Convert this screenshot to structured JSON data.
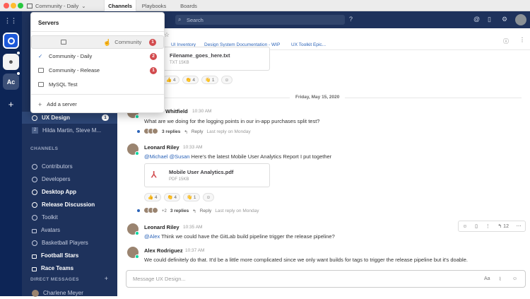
{
  "window": {
    "server_selector": "Community - Daily",
    "tabs": [
      "Channels",
      "Playbooks",
      "Boards"
    ]
  },
  "rail": {
    "team_initials": "Ac"
  },
  "global": {
    "search_placeholder": "Search"
  },
  "channel_header": {
    "bookmarks": [
      "UI Inventory",
      "Design System Documentation - WIP",
      "UX Toolkit Epic..."
    ]
  },
  "sidebar": {
    "items_top": [
      {
        "label": "UX Design",
        "badge": "1"
      },
      {
        "label": "Hilda Martin, Steve M...",
        "badge": "2"
      }
    ],
    "channels_title": "CHANNELS",
    "channels": [
      {
        "label": "Contributors",
        "bold": false,
        "lock": false
      },
      {
        "label": "Developers",
        "bold": false,
        "lock": false
      },
      {
        "label": "Desktop App",
        "bold": true,
        "lock": false
      },
      {
        "label": "Release Discussion",
        "bold": true,
        "lock": false
      },
      {
        "label": "Toolkit",
        "bold": false,
        "lock": false
      },
      {
        "label": "Avatars",
        "bold": false,
        "lock": true
      },
      {
        "label": "Basketball Players",
        "bold": false,
        "lock": false
      },
      {
        "label": "Football Stars",
        "bold": true,
        "lock": true
      },
      {
        "label": "Race Teams",
        "bold": true,
        "lock": true
      }
    ],
    "dm_title": "DIRECT MESSAGES",
    "dm_first": "Charlene Meyer"
  },
  "dropdown": {
    "title": "Servers",
    "servers": [
      {
        "name": "Community",
        "badge": "1",
        "selected": false
      },
      {
        "name": "Community - Daily",
        "badge": "2",
        "selected": true
      },
      {
        "name": "Community - Release",
        "badge": "1",
        "selected": false
      },
      {
        "name": "MySQL Test",
        "badge": "",
        "selected": false
      }
    ],
    "add_label": "Add a server"
  },
  "posts": {
    "top_file": {
      "name": "Filename_goes_here.txt",
      "meta": "TXT 15KB"
    },
    "top_reacts": [
      "👍 4",
      "👏 4",
      "👋 1",
      "☺"
    ],
    "date": "Friday, May 15, 2020",
    "p1": {
      "name": "Whitfield",
      "time": "10:30 AM",
      "text": "What are we doing for the logging points in our in-app purchases split test?",
      "thread": {
        "replies": "3 replies",
        "reply": "Reply",
        "last": "Last reply on Monday"
      }
    },
    "p2": {
      "name": "Leonard Riley",
      "time": "10:33 AM",
      "m1": "@Michael",
      "m2": "@Susan",
      "text": "Here's the latest Mobile User Analytics Report I put together",
      "file": {
        "name": "Mobile User Analytics.pdf",
        "meta": "PDF 15KB"
      },
      "reacts": [
        "👍 4",
        "👏 4",
        "👋 1",
        "☺"
      ],
      "thread": {
        "more": "+2",
        "replies": "3 replies",
        "reply": "Reply",
        "last": "Last reply on Monday"
      }
    },
    "p3": {
      "name": "Leonard Riley",
      "time": "10:35 AM",
      "mention": "@Alex",
      "text": "Think we could have the GitLab build pipeline trigger the release pipeline?",
      "hover_count": "12"
    },
    "p4": {
      "name": "Alex Rodriguez",
      "time": "10:37 AM",
      "text": "We could definitely do that. It'd be a little more complicated since we only want builds for tags to trigger the release pipeline but it's doable."
    }
  },
  "composer": {
    "placeholder": "Message UX Design..."
  }
}
